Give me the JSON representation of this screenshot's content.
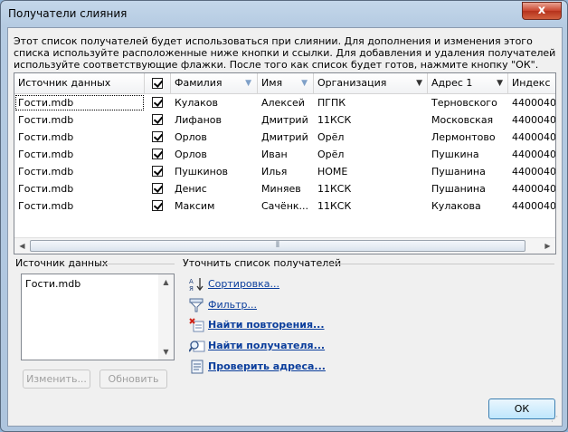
{
  "window": {
    "title": "Получатели слияния",
    "close_glyph": "x"
  },
  "description": "Этот список получателей будет использоваться при слиянии. Для дополнения и изменения этого списка используйте расположенные ниже кнопки и ссылки. Для добавления и удаления получателей используйте соответствующие флажки. После того как список будет готов, нажмите кнопку \"ОК\".",
  "grid": {
    "columns": [
      "Источник данных",
      "",
      "Фамилия",
      "Имя",
      "Организация",
      "Адрес 1",
      "Индекс"
    ],
    "rows": [
      {
        "source": "Гости.mdb",
        "checked": true,
        "surname": "Кулаков",
        "name": "Алексей",
        "org": "ПГПК",
        "addr": "Терновского",
        "index": "4400040"
      },
      {
        "source": "Гости.mdb",
        "checked": true,
        "surname": "Лифанов",
        "name": "Дмитрий",
        "org": "11КСК",
        "addr": "Московская",
        "index": "4400040"
      },
      {
        "source": "Гости.mdb",
        "checked": true,
        "surname": "Орлов",
        "name": "Дмитрий",
        "org": "Орёл",
        "addr": "Лермонтово",
        "index": "4400040"
      },
      {
        "source": "Гости.mdb",
        "checked": true,
        "surname": "Орлов",
        "name": "Иван",
        "org": "Орёл",
        "addr": "Пушкина",
        "index": "4400040"
      },
      {
        "source": "Гости.mdb",
        "checked": true,
        "surname": "Пушкинов",
        "name": "Илья",
        "org": "HOME",
        "addr": "Пушанина",
        "index": "4400040"
      },
      {
        "source": "Гости.mdb",
        "checked": true,
        "surname": "Денис",
        "name": "Миняев",
        "org": "11КСК",
        "addr": "Пушанина",
        "index": "4400040"
      },
      {
        "source": "Гости.mdb",
        "checked": true,
        "surname": "Максим",
        "name": "Сачёнк...",
        "org": "11КСК",
        "addr": "Кулакова",
        "index": "4400040"
      }
    ]
  },
  "source_group": {
    "label": "Источник данных",
    "items": [
      "Гости.mdb"
    ],
    "edit_label": "Изменить...",
    "refresh_label": "Обновить"
  },
  "refine_group": {
    "label": "Уточнить список получателей",
    "links": [
      {
        "label": "Сортировка...",
        "icon": "sort-az-icon"
      },
      {
        "label": "Фильтр...",
        "icon": "filter-funnel-icon"
      },
      {
        "label": "Найти повторения...",
        "icon": "find-duplicates-icon"
      },
      {
        "label": "Найти получателя...",
        "icon": "find-recipient-icon"
      },
      {
        "label": "Проверить адреса...",
        "icon": "validate-address-icon"
      }
    ]
  },
  "ok_label": "ОК"
}
